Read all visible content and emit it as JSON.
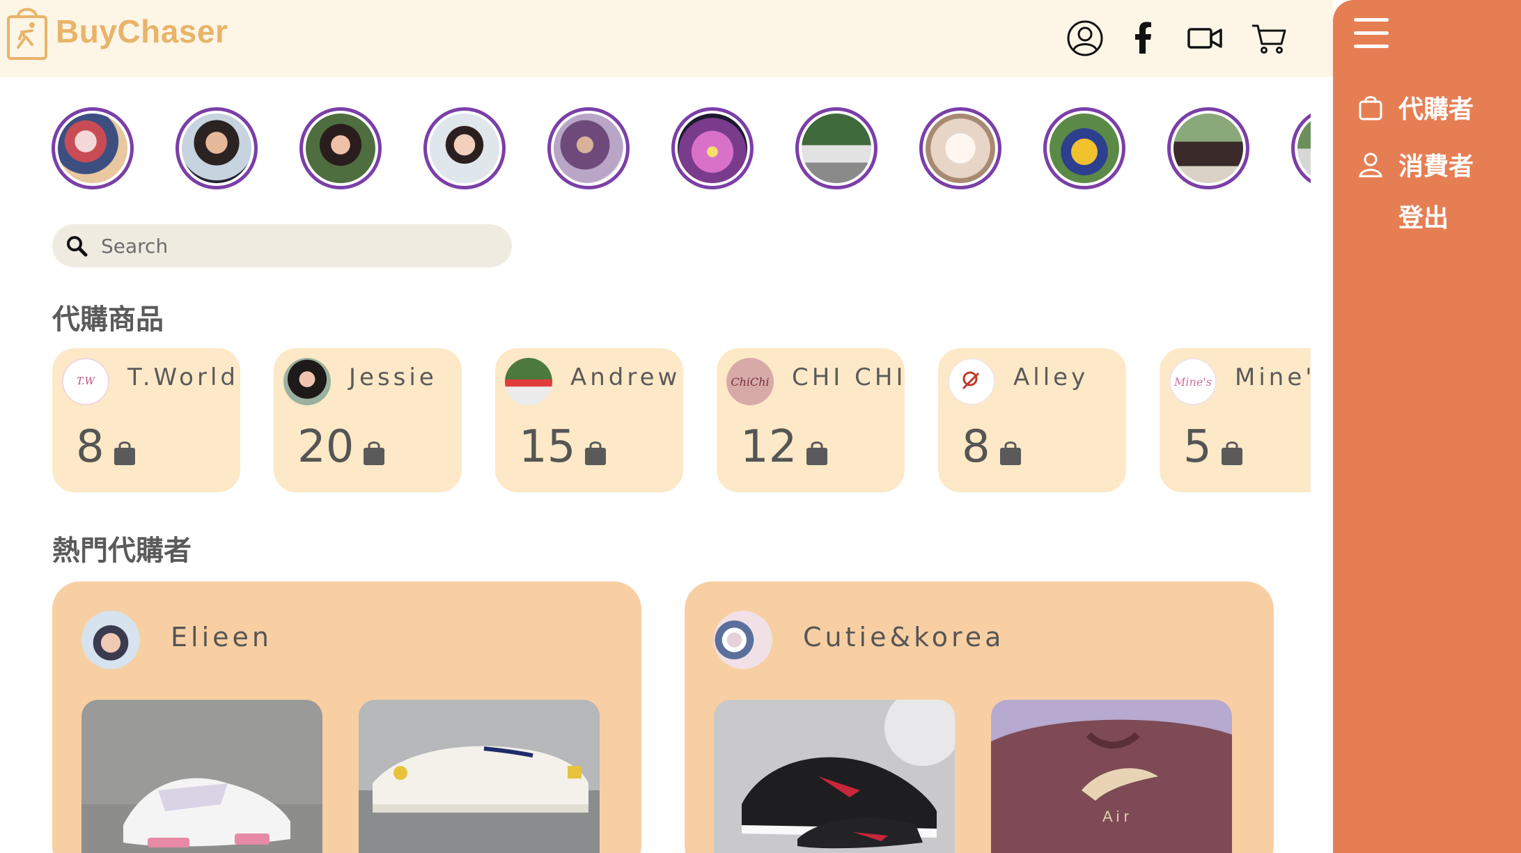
{
  "brand": {
    "name": "BuyChaser",
    "color": "#e8b46a"
  },
  "header": {
    "icons": [
      "user-circle-icon",
      "facebook-icon",
      "video-camera-icon",
      "shopping-cart-icon"
    ]
  },
  "stories": [
    {
      "name": "story-1"
    },
    {
      "name": "story-2"
    },
    {
      "name": "story-3"
    },
    {
      "name": "story-4"
    },
    {
      "name": "story-5"
    },
    {
      "name": "story-6"
    },
    {
      "name": "story-7"
    },
    {
      "name": "story-8"
    },
    {
      "name": "story-9"
    },
    {
      "name": "story-10"
    },
    {
      "name": "story-11"
    }
  ],
  "search": {
    "placeholder": "Search"
  },
  "sections": {
    "products_title": "代購商品",
    "popular_title": "熱門代購者"
  },
  "products": [
    {
      "name": "T.World",
      "count": "8"
    },
    {
      "name": "Jessie",
      "count": "20"
    },
    {
      "name": "Andrew",
      "count": "15"
    },
    {
      "name": "CHI CHI",
      "count": "12"
    },
    {
      "name": "Alley",
      "count": "8"
    },
    {
      "name": "Mine's",
      "count": "5"
    }
  ],
  "popular": [
    {
      "name": "Elieen"
    },
    {
      "name": "Cutie&korea"
    }
  ],
  "drawer": {
    "items": [
      {
        "label": "代購者",
        "icon": "shopping-bag-icon"
      },
      {
        "label": "消費者",
        "icon": "user-icon"
      },
      {
        "label": "登出",
        "icon": ""
      }
    ]
  },
  "colors": {
    "header_bg": "#fdf5e6",
    "drawer_bg": "#e67e54",
    "story_ring": "#7b3fa8",
    "product_card": "#fde9c7",
    "buyer_card": "#f8cfa3"
  }
}
